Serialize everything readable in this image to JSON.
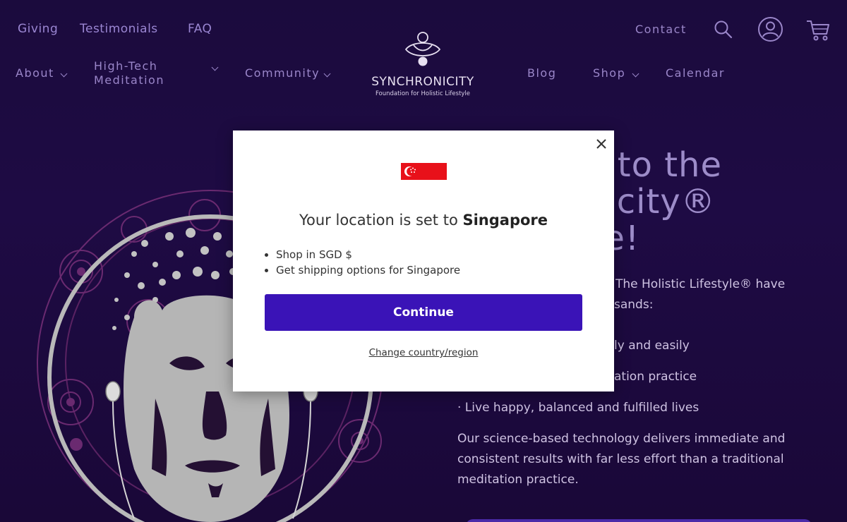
{
  "nav_top": {
    "giving": "Giving",
    "testimonials": "Testimonials",
    "faq": "FAQ",
    "contact": "Contact"
  },
  "nav_main": {
    "about": "About",
    "high_tech_line1": "High-Tech",
    "high_tech_line2": "Meditation",
    "community": "Community",
    "blog": "Blog",
    "shop": "Shop",
    "calendar": "Calendar"
  },
  "icons": {
    "search": "search-icon",
    "account": "account-icon",
    "cart": "cart-icon",
    "close": "close-icon",
    "flag": "singapore-flag-icon"
  },
  "logo": {
    "name": "SYNCHRONICITY",
    "tagline": "Foundation for Holistic Lifestyle"
  },
  "hero": {
    "title_line1": "e to the",
    "title_line2": "nicity®",
    "title_line3": "ce!",
    "intro_line1": "The Holistic Lifestyle® have",
    "intro_line2": "sands:",
    "bullet1_fragment": "ly and easily",
    "bullet2_fragment": "ation practice",
    "bullet3": "· Live happy, balanced and fulfilled lives",
    "body_line1": "Our science-based technology delivers immediate and",
    "body_line2": "consistent results with far less effort than a traditional",
    "body_line3": "meditation practice."
  },
  "modal": {
    "heading_prefix": "Your location is set to ",
    "heading_country": "Singapore",
    "bullets": [
      "Shop in SGD $",
      "Get shipping options for Singapore"
    ],
    "continue_label": "Continue",
    "change_label": "Change country/region"
  },
  "colors": {
    "background": "#1e0b44",
    "nav_text": "#9a86c9",
    "accent_button": "#3a13b7",
    "flag_red": "#e8111a"
  }
}
